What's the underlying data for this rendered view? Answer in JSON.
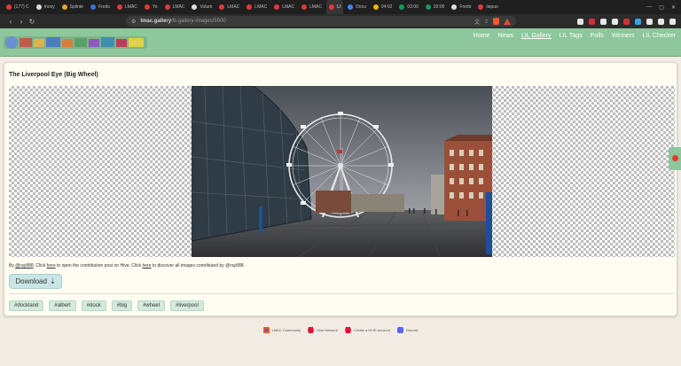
{
  "browser": {
    "tabs": [
      {
        "label": "(177) C",
        "color": "#e53935"
      },
      {
        "label": "Inoxy",
        "color": "#dddddd"
      },
      {
        "label": "Splinte",
        "color": "#e0a52c"
      },
      {
        "label": "Fredo",
        "color": "#3b6fe0"
      },
      {
        "label": "LMAC",
        "color": "#e53935"
      },
      {
        "label": "Yo",
        "color": "#e53935"
      },
      {
        "label": "LMAC",
        "color": "#e53935"
      },
      {
        "label": "Volum",
        "color": "#dddddd"
      },
      {
        "label": "LMAC",
        "color": "#e53935"
      },
      {
        "label": "LMAC",
        "color": "#e53935"
      },
      {
        "label": "LMAC",
        "color": "#e53935"
      },
      {
        "label": "LMAC",
        "color": "#e53935"
      },
      {
        "label": "LI",
        "color": "#e53935"
      },
      {
        "label": "Docu",
        "color": "#4285f4"
      },
      {
        "label": "04:02",
        "color": "#f4b400"
      },
      {
        "label": "03:00",
        "color": "#0f9d58"
      },
      {
        "label": "03:00",
        "color": "#0f9d58"
      },
      {
        "label": "Fredo",
        "color": "#dddddd"
      },
      {
        "label": "liepuo",
        "color": "#e53935"
      }
    ],
    "active_tab_index": 12,
    "url_host": "lmac.gallery",
    "url_path": "/lil-gallery-images/5500"
  },
  "site": {
    "nav": [
      "Home",
      "News",
      "LIL Gallery",
      "LIL Tags",
      "Polls",
      "Winners",
      "LIL Checker"
    ],
    "current_nav": "LIL Gallery",
    "header_color": "#8dc79b"
  },
  "image_page": {
    "title": "The Liverpool Eye (Big Wheel)",
    "credit": {
      "by": "By",
      "user": "@ray888",
      "text1": ". Click",
      "here1": "here",
      "text2": "to open the contribution post on Hive. Click",
      "here2": "here",
      "text3": "to discover all images contributed by @ray888."
    },
    "download_label": "Download",
    "download_icon": "download-arrow",
    "tags": [
      "#dockland",
      "#albert",
      "#dock",
      "#big",
      "#wheel",
      "#liverpool"
    ]
  },
  "footer": {
    "items": [
      "LMAC Community",
      "Hive Network",
      "Create a HIVE account",
      "Discord"
    ]
  }
}
